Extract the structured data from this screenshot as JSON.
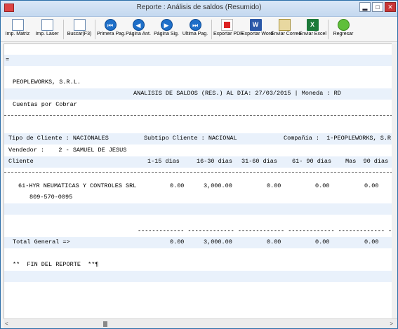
{
  "window": {
    "title": "Reporte : Análisis de saldos (Resumido)",
    "minimize": "▂",
    "maximize": "□",
    "close": "✕"
  },
  "toolbar": [
    {
      "label": "Imp. Matriz",
      "icon": "print-matrix-icon"
    },
    {
      "label": "Imp. Laser",
      "icon": "print-laser-icon"
    },
    {
      "label": "Buscar(F3)",
      "icon": "search-doc-icon"
    },
    {
      "label": "Primera Pag.",
      "icon": "first-page-icon",
      "glyph": "⏮"
    },
    {
      "label": "Página Ant.",
      "icon": "prev-page-icon",
      "glyph": "◀"
    },
    {
      "label": "Página Sig.",
      "icon": "next-page-icon",
      "glyph": "▶"
    },
    {
      "label": "Ultima Pag.",
      "icon": "last-page-icon",
      "glyph": "⏭"
    },
    {
      "label": "Exportar PDF",
      "icon": "pdf-icon"
    },
    {
      "label": "Exportar Word",
      "icon": "word-icon",
      "glyph": "W"
    },
    {
      "label": "Enviar Correo",
      "icon": "mail-icon"
    },
    {
      "label": "Enviar Excel",
      "icon": "excel-icon",
      "glyph": "X"
    },
    {
      "label": "Regresar",
      "icon": "back-icon"
    }
  ],
  "report": {
    "marker": "=",
    "company": "PEOPLEWORKS, S.R.L.",
    "report_title": "ANALISIS DE SALDOS (RES.) AL DIA: 27/03/2015 | Moneda : RD",
    "section": "Cuentas por Cobrar",
    "tipo_cliente": "Tipo de Cliente : NACIONALES",
    "subtipo_cliente": "Subtipo Cliente : NACIONAL",
    "compania": "Compañía :  1-PEOPLEWORKS, S.R.",
    "vendedor": "Vendedor :    2 - SAMUEL DE JESUS",
    "columns": [
      "Cliente",
      "1-15 dias",
      "16-30 dias",
      "31-60 dias",
      "61- 90 dias",
      "Mas  90 dias"
    ],
    "client": {
      "name": "61-HYR NEUMATICAS Y CONTROLES SRL",
      "values": [
        "0.00",
        "3,000.00",
        "0.00",
        "0.00",
        "0.00"
      ],
      "phone": "809-570-0095"
    },
    "dash_row": "------------- ------------- ------------- ------------- ------------- --",
    "total_label": "Total General =>",
    "total_values": [
      "0.00",
      "3,000.00",
      "0.00",
      "0.00",
      "0.00"
    ],
    "footer": "**  FIN DEL REPORTE  **¶"
  },
  "scroll": {
    "left": "<",
    "right": ">"
  }
}
